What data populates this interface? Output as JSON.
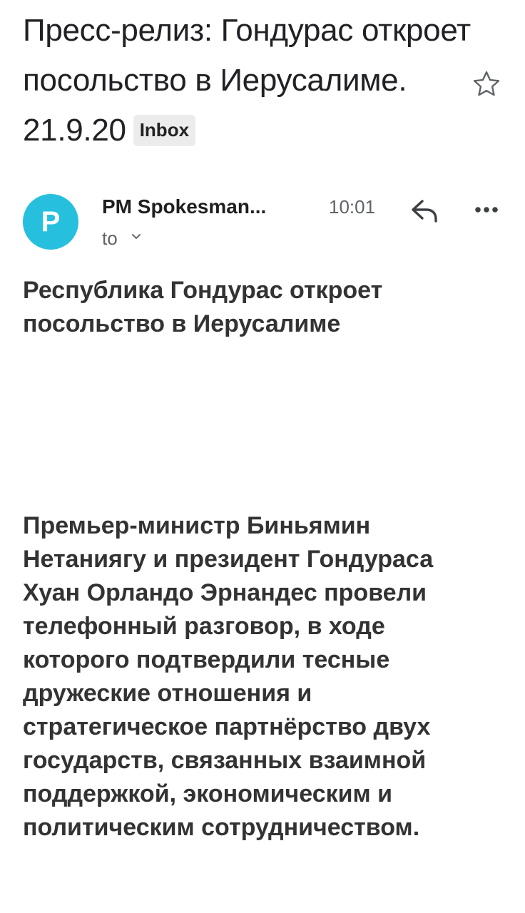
{
  "email": {
    "subject": "Пресс-релиз: Гондурас откроет посольство в Иерусалиме. 21.9.20",
    "label_badge": "Inbox",
    "sender": {
      "avatar_letter": "P",
      "avatar_color": "#26c0de",
      "name": "PM Spokesman...",
      "time": "10:01",
      "recipient_label": "to"
    },
    "headline_lines": [
      "Республика Гондурас откроет",
      "посольство в Иерусалиме"
    ],
    "body_lines": [
      "Премьер-министр Биньямин",
      "Нетаниягу и президент Гондураса",
      "Хуан Орландо Эрнандес провели",
      "телефонный разговор, в ходе",
      "которого подтвердили тесные",
      "дружеские отношения и",
      "стратегическое партнёрство двух",
      "государств, связанных взаимной",
      "поддержкой, экономическим и",
      "политическим сотрудничеством."
    ]
  },
  "icons": {
    "star": "star-outline-icon",
    "reply": "reply-arrow-icon",
    "more": "more-horizontal-icon",
    "recipient_expand": "chevron-down-icon"
  }
}
